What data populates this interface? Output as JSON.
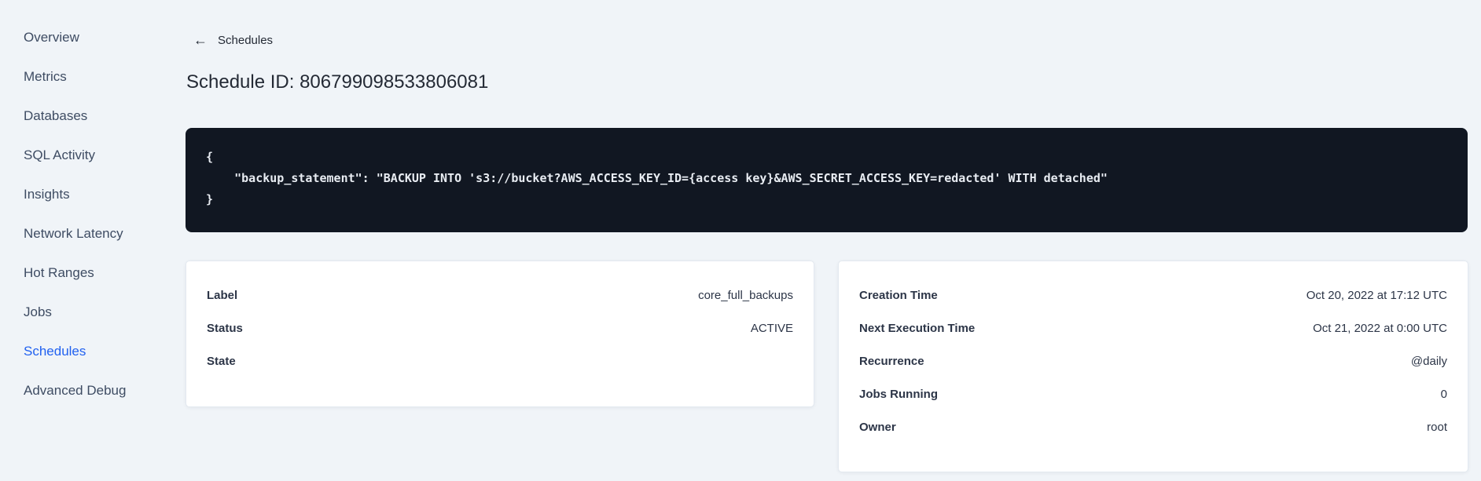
{
  "sidebar": {
    "active_item": "Schedules",
    "items": [
      {
        "label": "Overview"
      },
      {
        "label": "Metrics"
      },
      {
        "label": "Databases"
      },
      {
        "label": "SQL Activity"
      },
      {
        "label": "Insights"
      },
      {
        "label": "Network Latency"
      },
      {
        "label": "Hot Ranges"
      },
      {
        "label": "Jobs"
      },
      {
        "label": "Schedules"
      },
      {
        "label": "Advanced Debug"
      }
    ]
  },
  "header": {
    "back_label": "Schedules",
    "back_icon": "←",
    "title": "Schedule ID: 806799098533806081"
  },
  "code": {
    "lines": [
      "{",
      "    \"backup_statement\": \"BACKUP INTO 's3://bucket?AWS_ACCESS_KEY_ID={access key}&AWS_SECRET_ACCESS_KEY=redacted' WITH detached\"",
      "}"
    ]
  },
  "details_left": {
    "rows": [
      {
        "label": "Label",
        "value": "core_full_backups"
      },
      {
        "label": "Status",
        "value": "ACTIVE"
      },
      {
        "label": "State",
        "value": ""
      }
    ]
  },
  "details_right": {
    "rows": [
      {
        "label": "Creation Time",
        "value": "Oct 20, 2022 at 17:12 UTC"
      },
      {
        "label": "Next Execution Time",
        "value": "Oct 21, 2022 at 0:00 UTC"
      },
      {
        "label": "Recurrence",
        "value": "@daily"
      },
      {
        "label": "Jobs Running",
        "value": "0"
      },
      {
        "label": "Owner",
        "value": "root"
      }
    ]
  },
  "colors": {
    "page_background": "#f0f4f8",
    "sidebar_text": "#3e4c63",
    "sidebar_active": "#2161f0",
    "heading_text": "#242a35",
    "code_background": "#111722",
    "code_text": "#e8ecf2",
    "card_background": "#ffffff",
    "card_border": "#e3e9f0"
  }
}
